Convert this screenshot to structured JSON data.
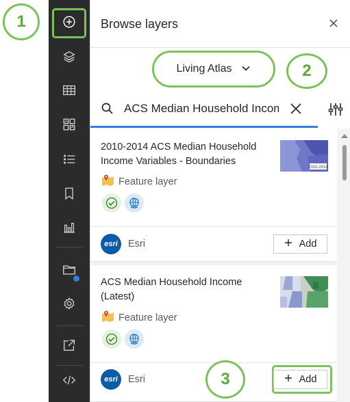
{
  "panel": {
    "title": "Browse layers",
    "source_selector": {
      "label": "Living Atlas"
    },
    "search": {
      "value": "ACS Median Household Income"
    }
  },
  "rail": {
    "items": [
      {
        "icon": "add-circle-icon"
      },
      {
        "icon": "layers-icon"
      },
      {
        "icon": "table-icon"
      },
      {
        "icon": "basemap-gallery-icon"
      },
      {
        "icon": "legend-list-icon"
      },
      {
        "icon": "bookmark-icon"
      },
      {
        "icon": "bar-chart-icon"
      },
      {
        "icon": "folder-icon"
      },
      {
        "icon": "settings-gear-icon"
      },
      {
        "icon": "share-icon"
      },
      {
        "icon": "embed-code-icon"
      }
    ]
  },
  "results": [
    {
      "title": "2010-2014 ACS Median Household Income Variables - Boundaries",
      "type": "Feature layer",
      "owner": "Esri",
      "add_label": "Add",
      "thumb_caption": "2010-2014"
    },
    {
      "title": "ACS Median Household Income (Latest)",
      "type": "Feature layer",
      "owner": "Esri",
      "add_label": "Add"
    }
  ],
  "logo_text": "esri",
  "callouts": [
    "1",
    "2",
    "3"
  ],
  "colors": {
    "rail_bg": "#2b2b2b",
    "accent_blue": "#2f7de1",
    "annotation_green": "#7cc15a",
    "esri_blue": "#0a5ca8"
  }
}
